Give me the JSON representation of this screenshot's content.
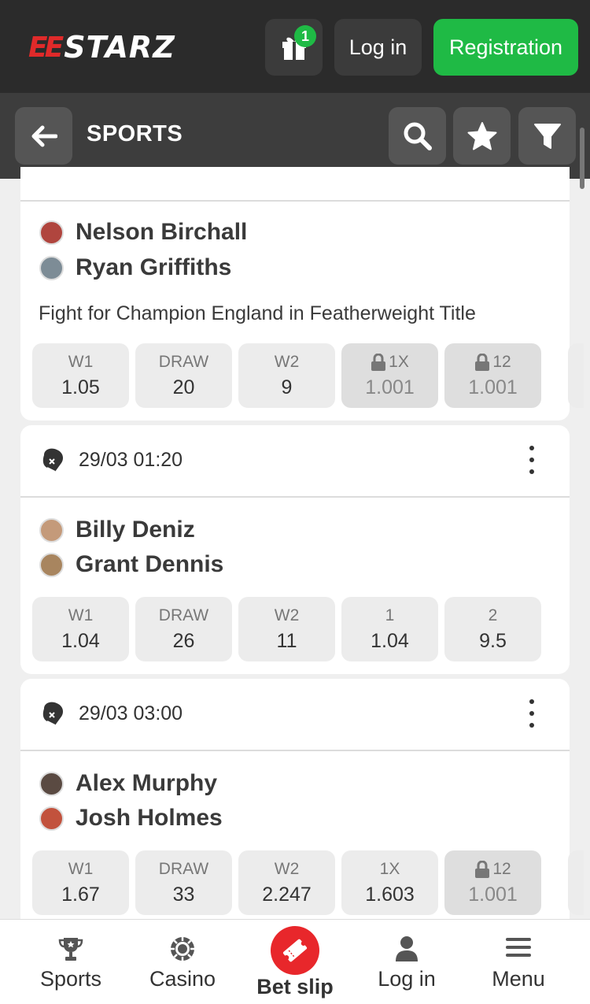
{
  "header": {
    "logo_prefix": "EE",
    "logo_text": "STARZ",
    "gift_count": "1",
    "login_label": "Log in",
    "register_label": "Registration"
  },
  "subheader": {
    "title": "SPORTS"
  },
  "matches": [
    {
      "team1": "Nelson Birchall",
      "team2": "Ryan Griffiths",
      "description": "Fight for Champion England in Featherweight Title",
      "odds": [
        {
          "label": "W1",
          "value": "1.05",
          "locked": false
        },
        {
          "label": "DRAW",
          "value": "20",
          "locked": false
        },
        {
          "label": "W2",
          "value": "9",
          "locked": false
        },
        {
          "label": "1X",
          "value": "1.001",
          "locked": true
        },
        {
          "label": "12",
          "value": "1.001",
          "locked": true
        }
      ]
    },
    {
      "datetime": "29/03 01:20",
      "team1": "Billy Deniz",
      "team2": "Grant Dennis",
      "odds": [
        {
          "label": "W1",
          "value": "1.04",
          "locked": false
        },
        {
          "label": "DRAW",
          "value": "26",
          "locked": false
        },
        {
          "label": "W2",
          "value": "11",
          "locked": false
        },
        {
          "label": "1",
          "value": "1.04",
          "locked": false
        },
        {
          "label": "2",
          "value": "9.5",
          "locked": false
        }
      ]
    },
    {
      "datetime": "29/03 03:00",
      "team1": "Alex Murphy",
      "team2": "Josh Holmes",
      "odds": [
        {
          "label": "W1",
          "value": "1.67",
          "locked": false
        },
        {
          "label": "DRAW",
          "value": "33",
          "locked": false
        },
        {
          "label": "W2",
          "value": "2.247",
          "locked": false
        },
        {
          "label": "1X",
          "value": "1.603",
          "locked": false
        },
        {
          "label": "12",
          "value": "1.001",
          "locked": true
        }
      ]
    }
  ],
  "bottom_nav": {
    "sports": "Sports",
    "casino": "Casino",
    "betslip": "Bet slip",
    "login": "Log in",
    "menu": "Menu"
  },
  "colors": {
    "accent_green": "#1fba45",
    "accent_red": "#e8272b",
    "header_bg": "#2b2b2b"
  }
}
